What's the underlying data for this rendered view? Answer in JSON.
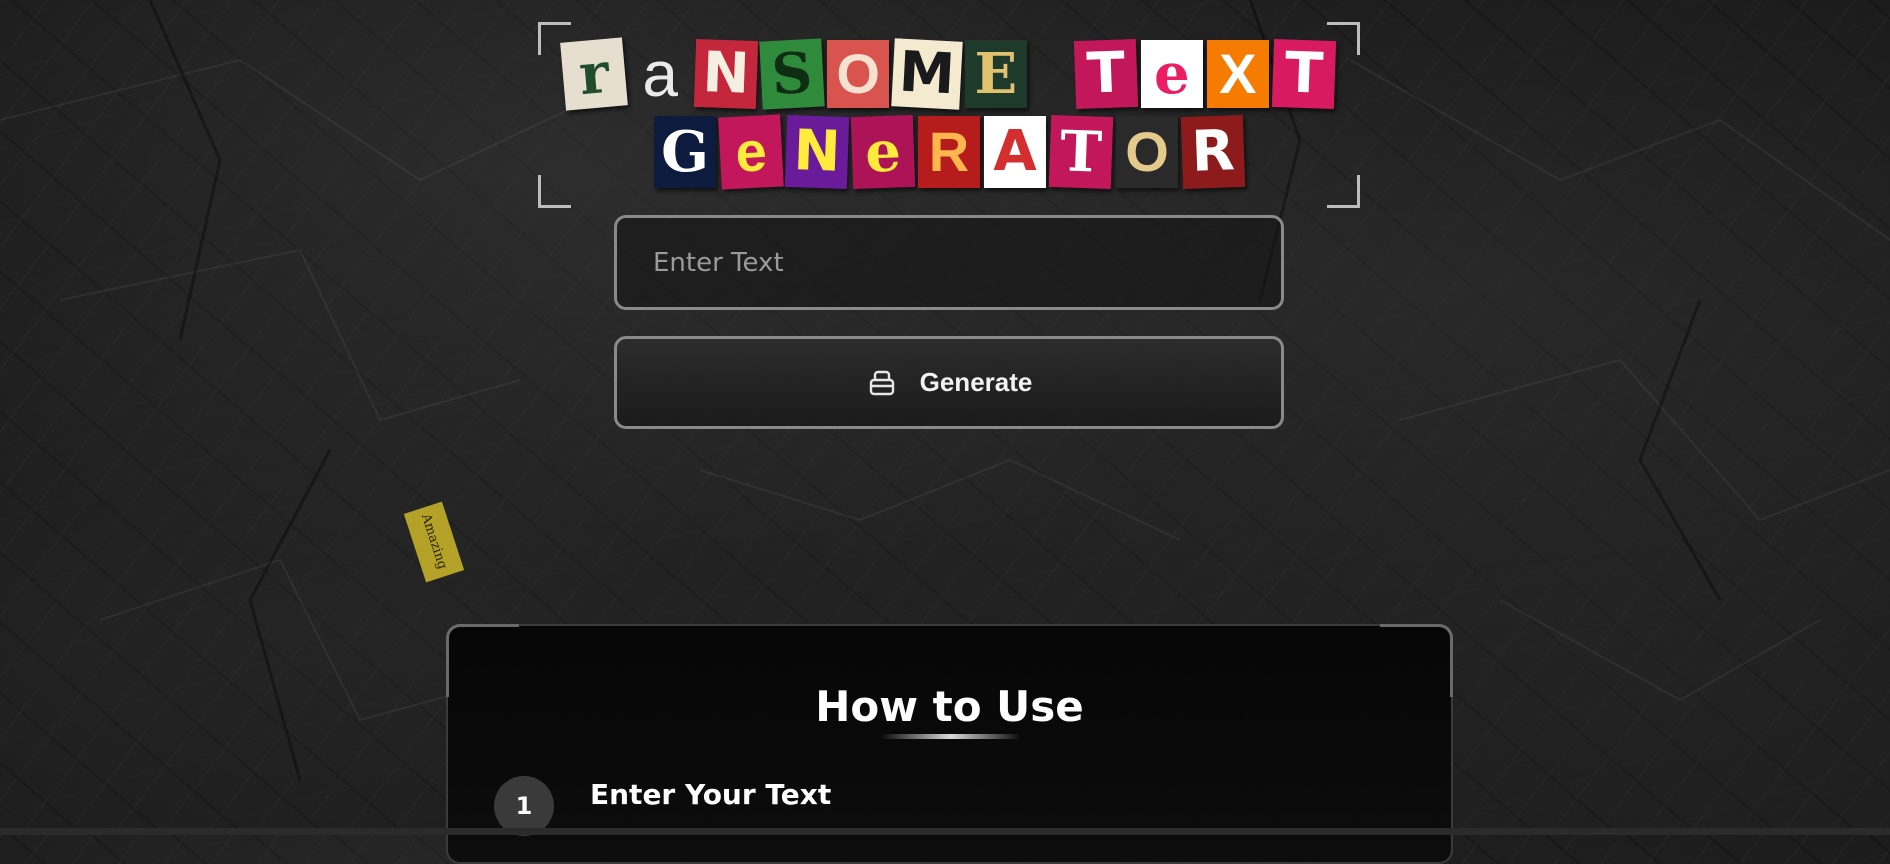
{
  "logo": {
    "alt": "Ransome Text Generator",
    "row1": [
      {
        "ch": "r",
        "bg": "#e6dfcf",
        "fg": "#1f4d2e",
        "rot": -5
      },
      {
        "ch": "a",
        "bg": "transparent",
        "fg": "#eaeaea",
        "rot": 0
      },
      {
        "ch": "N",
        "bg": "#c4273b",
        "fg": "#f4efe0",
        "rot": 2
      },
      {
        "ch": "S",
        "bg": "#2f8a3b",
        "fg": "#0e2d12",
        "rot": -3
      },
      {
        "ch": "O",
        "bg": "#d9534f",
        "fg": "#f6e2cf",
        "rot": 0
      },
      {
        "ch": "M",
        "bg": "#f3ead0",
        "fg": "#1a1a1a",
        "rot": 3
      },
      {
        "ch": "E",
        "bg": "#1e3a2a",
        "fg": "#e1c26e",
        "rot": 0
      },
      {
        "ch": "",
        "bg": "transparent",
        "fg": "transparent",
        "rot": 0
      },
      {
        "ch": "T",
        "bg": "#c2185b",
        "fg": "#ffffff",
        "rot": -2
      },
      {
        "ch": "e",
        "bg": "#ffffff",
        "fg": "#e91e63",
        "rot": 0
      },
      {
        "ch": "X",
        "bg": "#f57c00",
        "fg": "#ffffff",
        "rot": 0
      },
      {
        "ch": "T",
        "bg": "#d81b60",
        "fg": "#ffffff",
        "rot": 2
      }
    ],
    "row2": [
      {
        "ch": "G",
        "bg": "#0d1b3e",
        "fg": "#ffffff",
        "rot": 0
      },
      {
        "ch": "e",
        "bg": "#c2185b",
        "fg": "#ffeb3b",
        "rot": -3
      },
      {
        "ch": "N",
        "bg": "#6a1b9a",
        "fg": "#ffeb3b",
        "rot": 2
      },
      {
        "ch": "e",
        "bg": "#ad1457",
        "fg": "#ffeb3b",
        "rot": -2
      },
      {
        "ch": "R",
        "bg": "#b71c1c",
        "fg": "#ffb74d",
        "rot": 0
      },
      {
        "ch": "A",
        "bg": "#ffffff",
        "fg": "#d32f2f",
        "rot": 0
      },
      {
        "ch": "T",
        "bg": "#c2185b",
        "fg": "#ffffff",
        "rot": 2
      },
      {
        "ch": "O",
        "bg": "#2a2a2a",
        "fg": "#e3c98a",
        "rot": 0
      },
      {
        "ch": "R",
        "bg": "#8e1b1b",
        "fg": "#ffffff",
        "rot": -2
      }
    ]
  },
  "input": {
    "placeholder": "Enter Text",
    "value": ""
  },
  "generate": {
    "label": "Generate",
    "icon": "eraser-icon"
  },
  "sticker": {
    "text": "Amazing"
  },
  "how_to_use": {
    "title": "How to Use",
    "steps": [
      {
        "number": "1",
        "title": "Enter Your Text"
      }
    ]
  }
}
